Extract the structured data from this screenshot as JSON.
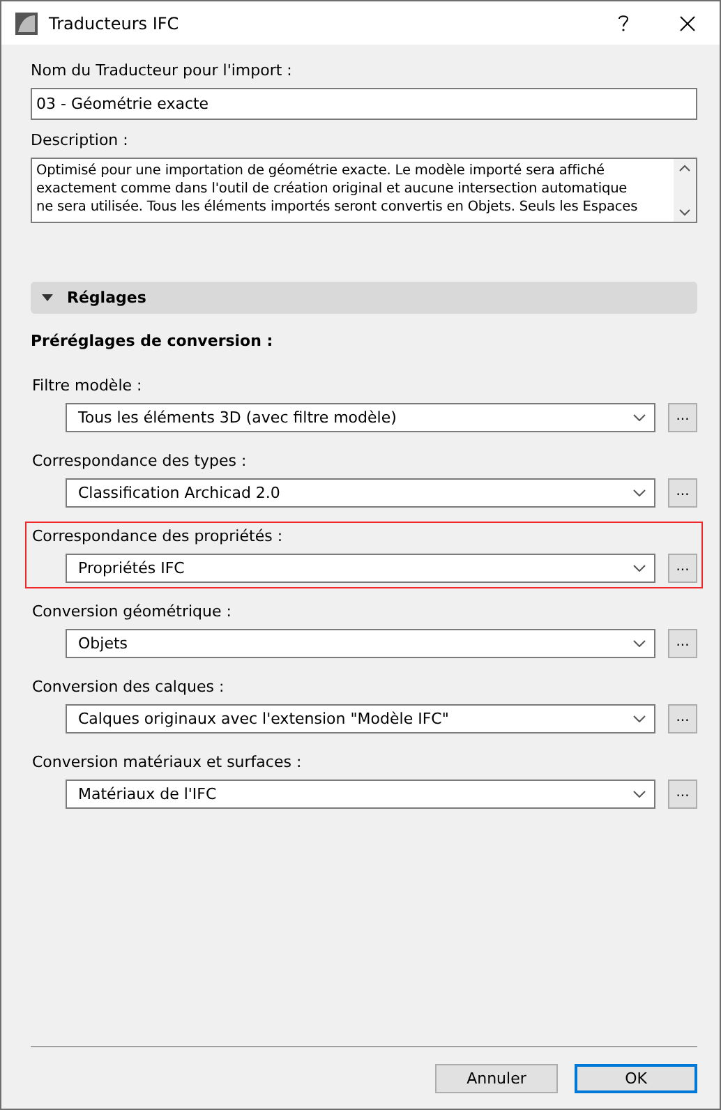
{
  "window": {
    "title": "Traducteurs IFC"
  },
  "name_field": {
    "label": "Nom du Traducteur pour l'import :",
    "value": "03 - Géométrie exacte"
  },
  "description": {
    "label": "Description :",
    "lines": [
      "Optimisé pour une importation de géométrie exacte. Le modèle importé sera affiché",
      "exactement comme dans l'outil de création original et aucune intersection automatique",
      "ne sera utilisée. Tous les éléments importés seront convertis en Objets. Seuls les Espaces"
    ]
  },
  "settings": {
    "title": "Réglages",
    "expanded": true,
    "subtitle": "Préréglages de conversion :",
    "items": [
      {
        "label": "Filtre modèle :",
        "value": "Tous les éléments 3D (avec filtre modèle)",
        "button": "...",
        "highlighted": false
      },
      {
        "label": "Correspondance des types :",
        "value": "Classification Archicad 2.0",
        "button": "...",
        "highlighted": false
      },
      {
        "label": "Correspondance des propriétés :",
        "value": "Propriétés IFC",
        "button": "...",
        "highlighted": true
      },
      {
        "label": "Conversion géométrique :",
        "value": "Objets",
        "button": "...",
        "highlighted": false
      },
      {
        "label": "Conversion des calques :",
        "value": "Calques originaux avec l'extension \"Modèle IFC\"",
        "button": "...",
        "highlighted": false
      },
      {
        "label": "Conversion matériaux et surfaces :",
        "value": "Matériaux de l'IFC",
        "button": "...",
        "highlighted": false
      }
    ]
  },
  "buttons": [
    {
      "label": "Annuler",
      "default": false
    },
    {
      "label": "OK",
      "default": true
    }
  ]
}
